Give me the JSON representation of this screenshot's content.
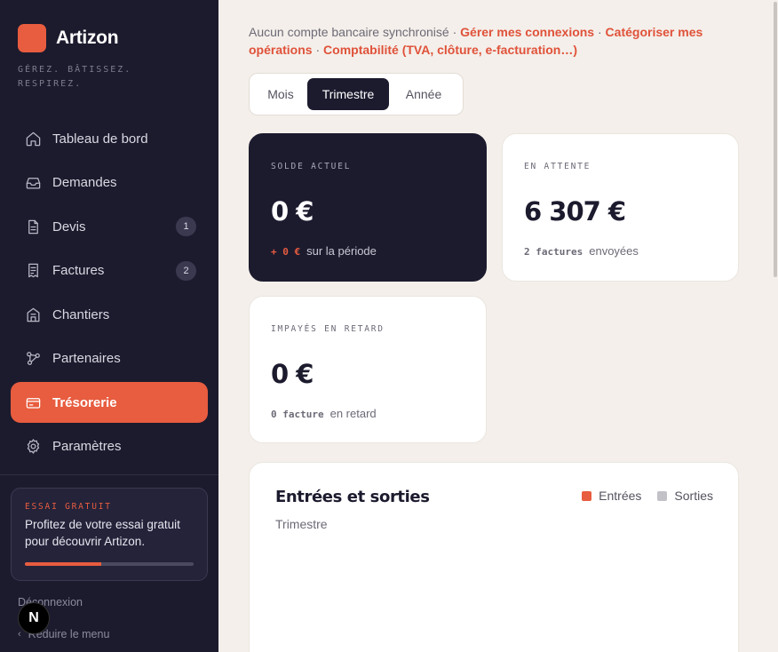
{
  "brand": {
    "name": "Artizon",
    "tagline": "GÉREZ. BÂTISSEZ. RESPIREZ.",
    "accent": "#e85c3f"
  },
  "sidebar": {
    "items": [
      {
        "label": "Tableau de bord",
        "icon": "home-icon",
        "badge": null,
        "active": false
      },
      {
        "label": "Demandes",
        "icon": "inbox-icon",
        "badge": null,
        "active": false
      },
      {
        "label": "Devis",
        "icon": "document-icon",
        "badge": "1",
        "active": false
      },
      {
        "label": "Factures",
        "icon": "receipt-icon",
        "badge": "2",
        "active": false
      },
      {
        "label": "Chantiers",
        "icon": "building-icon",
        "badge": null,
        "active": false
      },
      {
        "label": "Partenaires",
        "icon": "network-icon",
        "badge": null,
        "active": false
      },
      {
        "label": "Trésorerie",
        "icon": "credit-card-icon",
        "badge": null,
        "active": true
      },
      {
        "label": "Paramètres",
        "icon": "gear-icon",
        "badge": null,
        "active": false
      }
    ],
    "trial": {
      "label": "ESSAI GRATUIT",
      "text": "Profitez de votre essai gratuit pour découvrir Artizon.",
      "progress_percent": 45
    },
    "logout": "Déconnexion",
    "collapse": "Réduire le menu",
    "collapse_icon": "chevron-left-icon",
    "next_badge": "N"
  },
  "notice": {
    "text": "Aucun compte bancaire synchronisé",
    "sep": "·",
    "links": [
      "Gérer mes connexions",
      "Catégoriser mes opérations",
      "Comptabilité (TVA, clôture, e-facturation…)"
    ]
  },
  "period": {
    "options": [
      "Mois",
      "Trimestre",
      "Année"
    ],
    "selected": "Trimestre"
  },
  "cards": {
    "balance": {
      "label": "SOLDE ACTUEL",
      "value": "0 €",
      "delta": "+ 0 €",
      "delta_suffix": "sur la période"
    },
    "pending": {
      "label": "EN ATTENTE",
      "value": "6 307 €",
      "count": "2 factures",
      "count_suffix": "envoyées"
    },
    "overdue": {
      "label": "IMPAYÉS EN RETARD",
      "value": "0 €",
      "count": "0 facture",
      "count_suffix": "en retard"
    }
  },
  "cashflow": {
    "title": "Entrées et sorties",
    "subtitle": "Trimestre",
    "legend": [
      {
        "label": "Entrées",
        "color": "#e85c3f"
      },
      {
        "label": "Sorties",
        "color": "#c3c1c8"
      }
    ]
  }
}
